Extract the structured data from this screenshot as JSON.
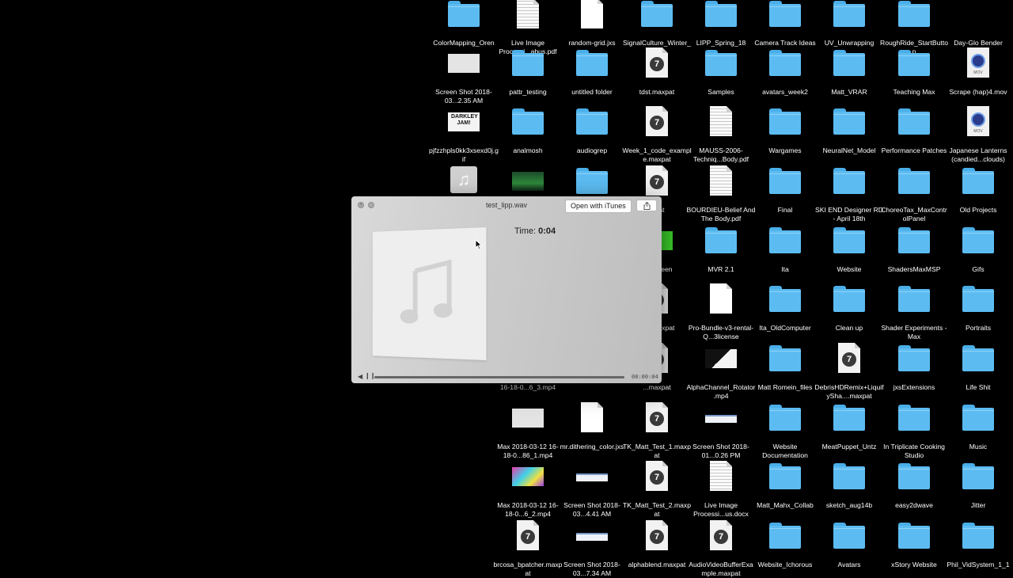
{
  "desktop": {
    "items": [
      {
        "label": "ColorMapping_Oren",
        "type": "folder"
      },
      {
        "label": "Live Image Processi...abus.pdf",
        "type": "pdf"
      },
      {
        "label": "random-grid.jxs",
        "type": "doc"
      },
      {
        "label": "SignalCulture_Winter_18",
        "type": "folder"
      },
      {
        "label": "LIPP_Spring_18",
        "type": "folder"
      },
      {
        "label": "Camera Track Ideas",
        "type": "folder"
      },
      {
        "label": "UV_Unwrapping",
        "type": "folder"
      },
      {
        "label": "RoughRide_StartButton",
        "type": "folder"
      },
      {
        "label": "Day-Glo Bender",
        "type": "dark"
      },
      {
        "label": "Screen Shot 2018-03...2.35 AM",
        "type": "img-grey"
      },
      {
        "label": "pattr_testing",
        "type": "folder"
      },
      {
        "label": "untitled folder",
        "type": "folder"
      },
      {
        "label": "tdst.maxpat",
        "type": "maxpat"
      },
      {
        "label": "Samples",
        "type": "folder"
      },
      {
        "label": "avatars_week2",
        "type": "folder"
      },
      {
        "label": "Matt_VRAR",
        "type": "folder"
      },
      {
        "label": "Teaching Max",
        "type": "folder"
      },
      {
        "label": "Scrape (hap)4.mov",
        "type": "mov"
      },
      {
        "label": "pjfzzhpls0kk3xsexd0j.gif",
        "type": "img-jam"
      },
      {
        "label": "analmosh",
        "type": "folder"
      },
      {
        "label": "audiogrep",
        "type": "folder"
      },
      {
        "label": "Week_1_code_example.maxpat",
        "type": "maxpat"
      },
      {
        "label": "MAUSS-2006-Techniq...Body.pdf",
        "type": "pdf"
      },
      {
        "label": "Wargames",
        "type": "folder"
      },
      {
        "label": "NeuralNet_Model",
        "type": "folder"
      },
      {
        "label": "Performance Patches",
        "type": "folder"
      },
      {
        "label": "Japanese Lanterns (candied...clouds)",
        "type": "mov"
      },
      {
        "label": "",
        "type": "audio"
      },
      {
        "label": "",
        "type": "img-green"
      },
      {
        "label": "",
        "type": "folder"
      },
      {
        "label": "...pat",
        "type": "maxpat"
      },
      {
        "label": "BOURDIEU-Belief And The Body.pdf",
        "type": "pdf"
      },
      {
        "label": "Final",
        "type": "folder"
      },
      {
        "label": "SKI END Designer RD - April 18th",
        "type": "folder"
      },
      {
        "label": "ChoreoTax_MaxControlPanel",
        "type": "folder"
      },
      {
        "label": "Old Projects",
        "type": "folder"
      },
      {
        "label": "...nScreen",
        "type": "img-greenbar"
      },
      {
        "label": "MVR 2.1",
        "type": "folder"
      },
      {
        "label": "Ita",
        "type": "folder"
      },
      {
        "label": "Website",
        "type": "folder"
      },
      {
        "label": "ShadersMaxMSP",
        "type": "folder"
      },
      {
        "label": "Gifs",
        "type": "folder"
      },
      {
        "label": "...g a ...xpat",
        "type": "maxpat"
      },
      {
        "label": "Pro-Bundle-v3-rental-Q...3license",
        "type": "doc"
      },
      {
        "label": "Ita_OldComputer",
        "type": "folder"
      },
      {
        "label": "Clean up",
        "type": "folder"
      },
      {
        "label": "Shader Experiments - Max",
        "type": "folder"
      },
      {
        "label": "Portraits",
        "type": "folder"
      },
      {
        "label": "16-18-0...6_3.mp4",
        "type": "none"
      },
      {
        "label": "...maxpat",
        "type": "maxpat"
      },
      {
        "label": "AlphaChannel_Rotator.mp4",
        "type": "img-dark"
      },
      {
        "label": "Matt Romein_files",
        "type": "folder"
      },
      {
        "label": "DebrisHDRemix+LiquifySha....maxpat",
        "type": "maxpat"
      },
      {
        "label": "jxsExtensions",
        "type": "folder"
      },
      {
        "label": "Life Shit",
        "type": "folder"
      },
      {
        "label": "Max 2018-03-12 16-18-0...86_1.mp4",
        "type": "img-grey"
      },
      {
        "label": "mr.dithering_color.jxs",
        "type": "doc"
      },
      {
        "label": "TK_Matt_Test_1.maxpat",
        "type": "maxpat"
      },
      {
        "label": "Screen Shot 2018-01...0.26 PM",
        "type": "img-line"
      },
      {
        "label": "Website Documentation",
        "type": "folder"
      },
      {
        "label": "MeatPuppet_Untz",
        "type": "folder"
      },
      {
        "label": "In Triplicate Cooking Studio",
        "type": "folder"
      },
      {
        "label": "Music",
        "type": "folder"
      },
      {
        "label": "Max 2018-03-12 16-18-0...6_2.mp4",
        "type": "img-colorful"
      },
      {
        "label": "Screen Shot 2018-03...4.41 AM",
        "type": "img-line"
      },
      {
        "label": "TK_Matt_Test_2.maxpat",
        "type": "maxpat"
      },
      {
        "label": "Live Image Processi...us.docx",
        "type": "pdf"
      },
      {
        "label": "Matt_Mahx_Collab",
        "type": "folder"
      },
      {
        "label": "sketch_aug14b",
        "type": "folder"
      },
      {
        "label": "easy2dwave",
        "type": "folder"
      },
      {
        "label": "Jitter",
        "type": "folder"
      },
      {
        "label": "brcosa_bpatcher.maxpat",
        "type": "maxpat"
      },
      {
        "label": "Screen Shot 2018-03...7.34 AM",
        "type": "img-line"
      },
      {
        "label": "alphablend.maxpat",
        "type": "maxpat"
      },
      {
        "label": "AudioVideoBufferExample.maxpat",
        "type": "maxpat"
      },
      {
        "label": "Website_Ichorous",
        "type": "folder"
      },
      {
        "label": "Avatars",
        "type": "folder"
      },
      {
        "label": "xStory Website",
        "type": "folder"
      },
      {
        "label": "Phil_VidSystem_1_1",
        "type": "folder"
      }
    ]
  },
  "quicklook": {
    "title": "test_lipp.wav",
    "open_button": "Open with iTunes",
    "time_label": "Time:",
    "time_value": "0:04",
    "elapsed": "00:00:04",
    "progress": 1.0,
    "icons": {
      "close": "close-icon",
      "fullscreen": "fullscreen-icon",
      "share": "share-icon",
      "art": "music-note-icon",
      "play": "play-icon",
      "pause": "pause-icon"
    }
  }
}
